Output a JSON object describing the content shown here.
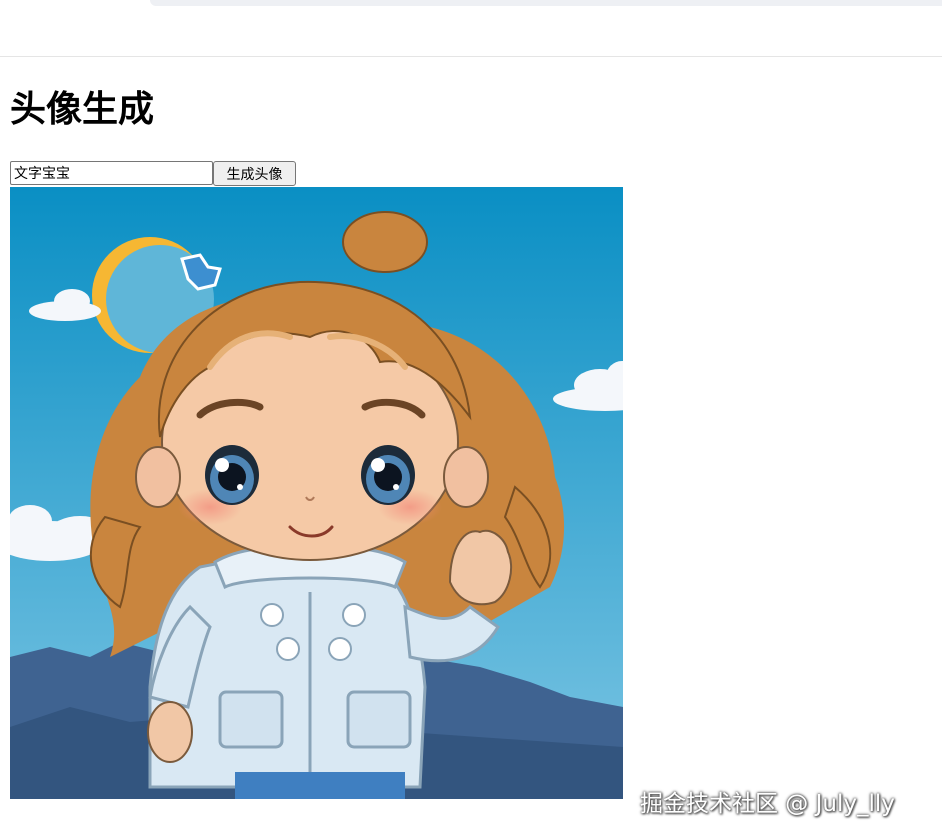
{
  "page": {
    "title": "头像生成"
  },
  "form": {
    "input_value": "文字宝宝",
    "button_label": "生成头像"
  },
  "avatar": {
    "subject": "cartoon girl with curly hair and light blue jacket waving"
  },
  "watermark": {
    "text": "掘金技术社区 @ July_lly"
  },
  "colors": {
    "sky_top": "#0a8fc4",
    "sky_bottom": "#7cc5e3",
    "hair": "#c9853e",
    "jacket": "#d9e8f3",
    "mountains": "#3f6391"
  }
}
